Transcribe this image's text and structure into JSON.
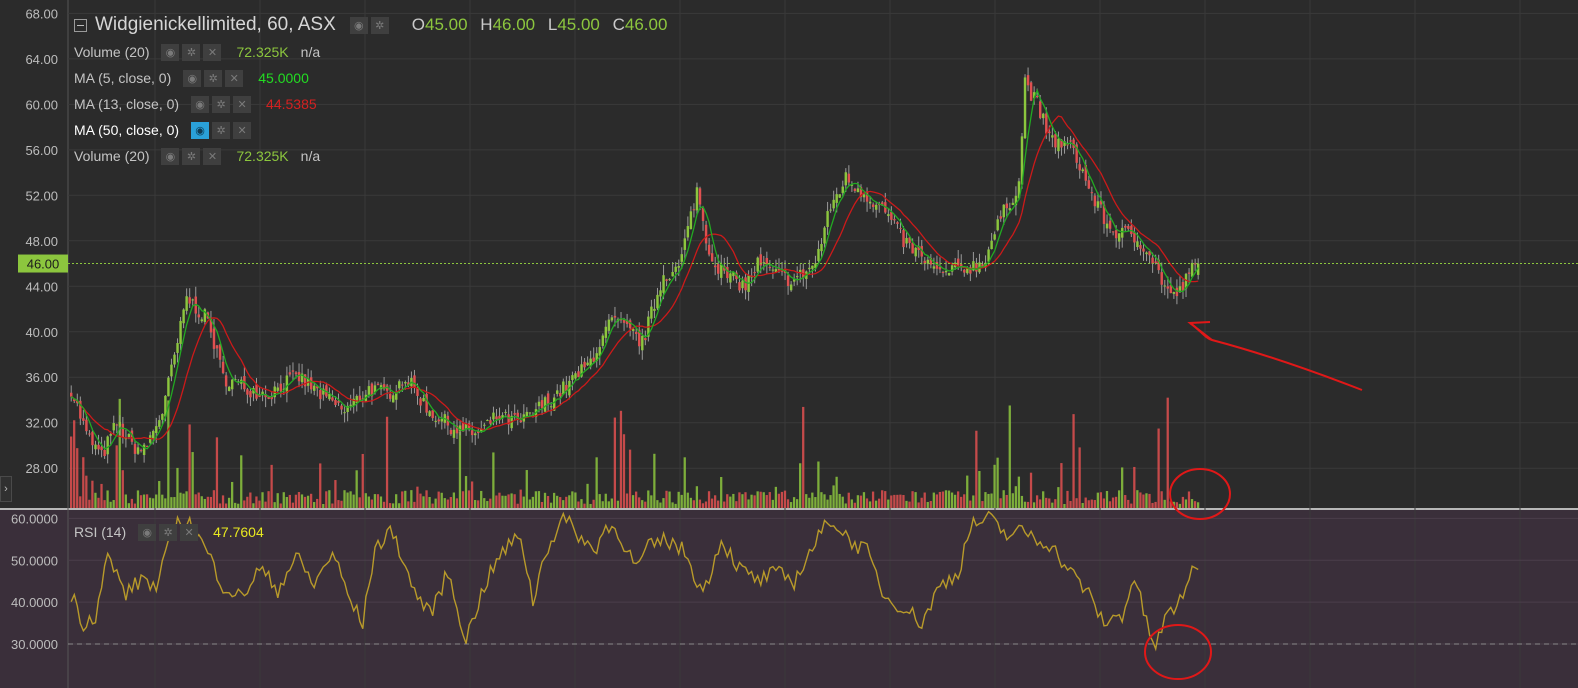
{
  "header": {
    "title": "Widgienickellimited, 60, ASX",
    "ohlc": {
      "o_label": "O",
      "o_value": "45.00",
      "h_label": "H",
      "h_value": "46.00",
      "l_label": "L",
      "l_value": "45.00",
      "c_label": "C",
      "c_value": "46.00"
    }
  },
  "indicators": [
    {
      "name": "Volume (20)",
      "value": "72.325K",
      "extra": "n/a",
      "value_color": "#8cc63e"
    },
    {
      "name": "MA (5, close, 0)",
      "value": "45.0000",
      "extra": "",
      "value_color": "#22dd22"
    },
    {
      "name": "MA (13, close, 0)",
      "value": "44.5385",
      "extra": "",
      "value_color": "#d42020"
    },
    {
      "name": "MA (50, close, 0)",
      "value": "",
      "extra": "",
      "value_color": "#ffffff"
    },
    {
      "name": "Volume (20)",
      "value": "72.325K",
      "extra": "n/a",
      "value_color": "#8cc63e"
    }
  ],
  "rsi_panel": {
    "name": "RSI (14)",
    "value": "47.7604",
    "value_color": "#e8e820"
  },
  "icons": {
    "eye": "eye-icon",
    "gear": "gear-icon",
    "close": "close-icon",
    "collapse": "collapse-icon",
    "expand": "chevron-right-icon"
  },
  "colors": {
    "up": "#8cc63e",
    "down": "#e05050",
    "ma_fast": "#22aa22",
    "ma_slow": "#cc1a1a",
    "rsi_line": "#b89a2a",
    "rsi_bg": "#3a2f3a",
    "price_bg": "#2b2b2b",
    "grid": "#3a3a3a",
    "annotation": "#e01818",
    "last_price": "#8cc63e"
  },
  "chart_data": {
    "type": "candlestick",
    "price_axis": {
      "ticks": [
        "68.00",
        "64.00",
        "60.00",
        "56.00",
        "52.00",
        "48.00",
        "44.00",
        "40.00",
        "36.00",
        "32.00",
        "28.00"
      ],
      "ylim": [
        24.5,
        69.0
      ],
      "last_price_label": "46.00",
      "last_price": 46.0
    },
    "price_anchors": [
      [
        0,
        35
      ],
      [
        5,
        31
      ],
      [
        10,
        29
      ],
      [
        15,
        32
      ],
      [
        20,
        30
      ],
      [
        24,
        29.5
      ],
      [
        30,
        33
      ],
      [
        35,
        39
      ],
      [
        38,
        43
      ],
      [
        45,
        41
      ],
      [
        50,
        36
      ],
      [
        58,
        35
      ],
      [
        65,
        34.5
      ],
      [
        70,
        35.5
      ],
      [
        75,
        36
      ],
      [
        82,
        34.5
      ],
      [
        90,
        33
      ],
      [
        98,
        35
      ],
      [
        104,
        34.5
      ],
      [
        110,
        36
      ],
      [
        118,
        33
      ],
      [
        126,
        31.5
      ],
      [
        134,
        31
      ],
      [
        140,
        32.5
      ],
      [
        148,
        32
      ],
      [
        155,
        33.5
      ],
      [
        162,
        35
      ],
      [
        170,
        37
      ],
      [
        178,
        41
      ],
      [
        184,
        40
      ],
      [
        188,
        39
      ],
      [
        195,
        45
      ],
      [
        200,
        45.5
      ],
      [
        206,
        52.5
      ],
      [
        210,
        47
      ],
      [
        215,
        45
      ],
      [
        222,
        44
      ],
      [
        226,
        46
      ],
      [
        232,
        45
      ],
      [
        238,
        44.5
      ],
      [
        245,
        46
      ],
      [
        250,
        51
      ],
      [
        255,
        53.5
      ],
      [
        262,
        52
      ],
      [
        268,
        50.5
      ],
      [
        274,
        48
      ],
      [
        280,
        46.5
      ],
      [
        286,
        45
      ],
      [
        292,
        45.5
      ],
      [
        300,
        46
      ],
      [
        306,
        50
      ],
      [
        312,
        53
      ],
      [
        314,
        62
      ],
      [
        318,
        60
      ],
      [
        322,
        57
      ],
      [
        330,
        56
      ],
      [
        336,
        52
      ],
      [
        342,
        49
      ],
      [
        348,
        48.5
      ],
      [
        354,
        47.5
      ],
      [
        360,
        44
      ],
      [
        363,
        43
      ],
      [
        366,
        44
      ],
      [
        370,
        46
      ]
    ],
    "volume": {
      "name": "Volume (20)",
      "ylim": [
        0,
        28000000
      ],
      "values_scale": "relative"
    },
    "rsi": {
      "name": "RSI (14)",
      "ticks": [
        "60.0000",
        "50.0000",
        "40.0000",
        "30.0000"
      ],
      "ylim": [
        19.5,
        62.0
      ],
      "level": 30,
      "anchors": [
        [
          0,
          42
        ],
        [
          4,
          35
        ],
        [
          8,
          37
        ],
        [
          12,
          51
        ],
        [
          18,
          42
        ],
        [
          24,
          46
        ],
        [
          28,
          43
        ],
        [
          34,
          58
        ],
        [
          38,
          60
        ],
        [
          44,
          53
        ],
        [
          50,
          44
        ],
        [
          56,
          41
        ],
        [
          62,
          48
        ],
        [
          68,
          43
        ],
        [
          74,
          51
        ],
        [
          80,
          44
        ],
        [
          86,
          52
        ],
        [
          92,
          40
        ],
        [
          96,
          35
        ],
        [
          100,
          53
        ],
        [
          106,
          57
        ],
        [
          112,
          44
        ],
        [
          118,
          37
        ],
        [
          124,
          47
        ],
        [
          130,
          31
        ],
        [
          136,
          44
        ],
        [
          142,
          52
        ],
        [
          148,
          56
        ],
        [
          152,
          40
        ],
        [
          156,
          52
        ],
        [
          162,
          60
        ],
        [
          166,
          57
        ],
        [
          172,
          52
        ],
        [
          176,
          58
        ],
        [
          180,
          57
        ],
        [
          186,
          48
        ],
        [
          190,
          53
        ],
        [
          196,
          55
        ],
        [
          202,
          52
        ],
        [
          208,
          42
        ],
        [
          214,
          55
        ],
        [
          220,
          48
        ],
        [
          226,
          45
        ],
        [
          232,
          47
        ],
        [
          238,
          45
        ],
        [
          244,
          53
        ],
        [
          250,
          60
        ],
        [
          256,
          55
        ],
        [
          262,
          52
        ],
        [
          268,
          41
        ],
        [
          274,
          39
        ],
        [
          280,
          35
        ],
        [
          286,
          44
        ],
        [
          292,
          47
        ],
        [
          296,
          58
        ],
        [
          302,
          60
        ],
        [
          308,
          56
        ],
        [
          314,
          57
        ],
        [
          318,
          55
        ],
        [
          322,
          54
        ],
        [
          328,
          48
        ],
        [
          334,
          43
        ],
        [
          340,
          35
        ],
        [
          346,
          37
        ],
        [
          350,
          46
        ],
        [
          354,
          35
        ],
        [
          357,
          29
        ],
        [
          360,
          36
        ],
        [
          364,
          39
        ],
        [
          368,
          46
        ],
        [
          371,
          47.8
        ]
      ]
    }
  }
}
